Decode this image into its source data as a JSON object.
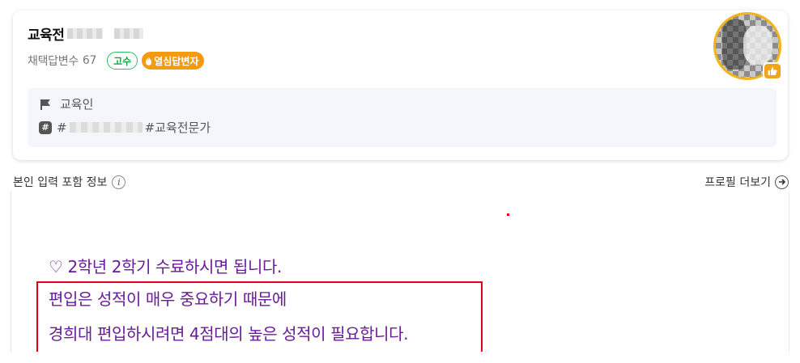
{
  "profile": {
    "name": "교육전",
    "adopted_label": "채택답변수",
    "adopted_count": "67",
    "badge_level": "고수",
    "badge_hot": "열심답변자",
    "category_label": "교육인",
    "tags_prefix": "#",
    "tags_suffix": "#교육전문가"
  },
  "meta": {
    "self_info_label": "본인 입력 포함 정보",
    "info_symbol": "i",
    "more_profile_label": "프로필 더보기"
  },
  "answer": {
    "line1": "♡ 2학년 2학기 수료하시면 됩니다.",
    "line2": "편입은 성적이 매우 중요하기 때문에",
    "line3": "경희대 편입하시려면 4점대의 높은 성적이 필요합니다."
  },
  "colors": {
    "badge_green": "#14a845",
    "badge_orange": "#f39a10",
    "answer_purple": "#6a1b9a",
    "highlight_red": "#e3001b",
    "avatar_ring": "#f4b21b"
  },
  "icons": [
    "flame-icon",
    "flag-icon",
    "hash-icon",
    "info-icon",
    "arrow-right-circle-icon",
    "thumbs-up-icon"
  ]
}
